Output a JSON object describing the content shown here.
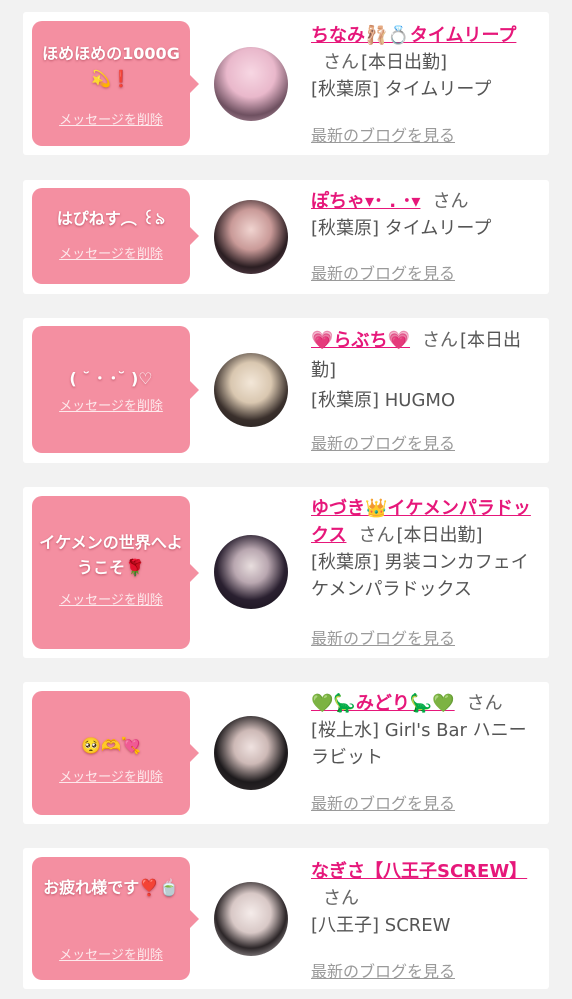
{
  "accent_pink": "#f48fa1",
  "name_color": "#e6177a",
  "entries": [
    {
      "message": "ほめほめの1000G💫❗",
      "delete_label": "メッセージを削除",
      "name": "ちなみ🩰💍タイムリープ",
      "san": "さん",
      "status": "[本日出勤]",
      "shop": "[秋葉原] タイムリープ",
      "blog": "最新のブログを見る"
    },
    {
      "message": "はぴねす︵ ꒰৯ ",
      "delete_label": "メッセージを削除",
      "name": "ぽちゃ▾･ . ･▾",
      "san": "さん",
      "status": "",
      "shop": "[秋葉原] タイムリープ",
      "blog": "最新のブログを見る"
    },
    {
      "message": "( ˘ ･ ･˘ )♡",
      "delete_label": "メッセージを削除",
      "name": "💗らぶち💗",
      "san": "さん",
      "status": "[本日出勤]",
      "shop": "[秋葉原] HUGMO",
      "blog": "最新のブログを見る"
    },
    {
      "message": "イケメンの世界へようこそ🌹",
      "delete_label": "メッセージを削除",
      "name": "ゆづき👑イケメンパラドックス",
      "san": "さん",
      "status": "[本日出勤]",
      "shop": "[秋葉原] 男装コンカフェイケメンパラドックス",
      "blog": "最新のブログを見る"
    },
    {
      "message": "🥺🫶💘",
      "delete_label": "メッセージを削除",
      "name": "💚🦕みどり🦕💚",
      "san": "さん",
      "status": "",
      "shop": "[桜上水] Girl's Bar ハニーラビット",
      "blog": "最新のブログを見る"
    },
    {
      "message": "お疲れ様です❣️🍵",
      "delete_label": "メッセージを削除",
      "name": "なぎさ【八王子SCREW】",
      "san": "さん",
      "status": "",
      "shop": "[八王子] SCREW",
      "blog": "最新のブログを見る"
    }
  ]
}
